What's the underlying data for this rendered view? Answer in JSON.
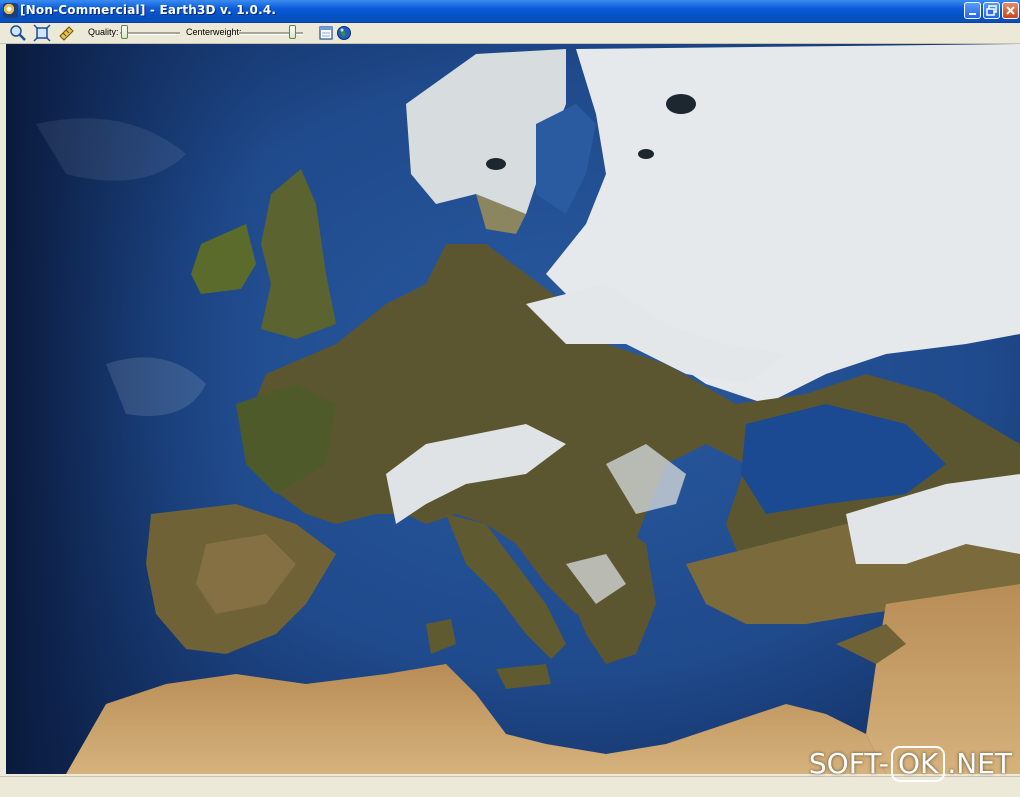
{
  "window": {
    "title": "[Non-Commercial] - Earth3D v. 1.0.4.",
    "buttons": [
      "minimize",
      "restore",
      "close"
    ]
  },
  "toolbar": {
    "icons": [
      "zoom-icon",
      "reset-view-icon",
      "satellite-icon"
    ],
    "quality_label": "Quality:",
    "centerweight_label": "Centerweight:",
    "quality_level": 0.0,
    "centerweight_level": 0.85,
    "right_icons": [
      "panel-icon",
      "globe-icon"
    ]
  },
  "watermark": {
    "part1": "SOFT-",
    "part2": "OK",
    "part3": ".NET"
  },
  "colors": {
    "titlebar": "#0552c7",
    "ocean": "#1d3b72",
    "land": "#5a5a2e",
    "snow": "#eef1f3",
    "desert": "#c9a06a"
  }
}
